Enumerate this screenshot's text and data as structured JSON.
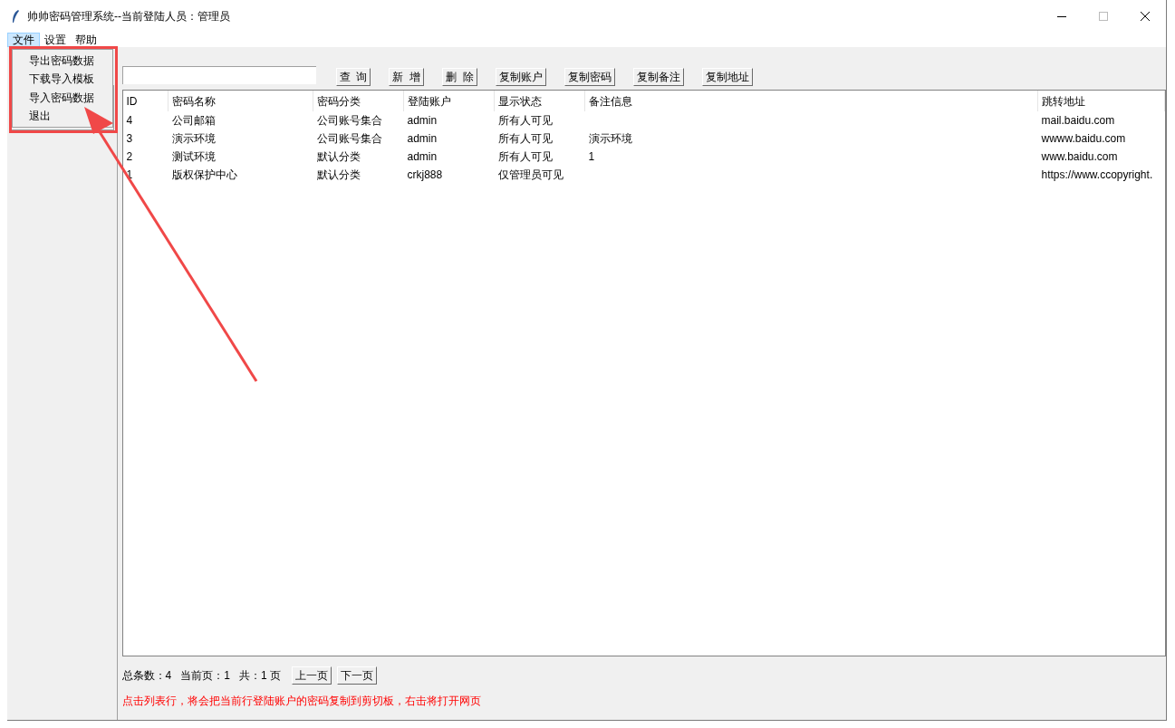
{
  "window": {
    "title": "帅帅密码管理系统--当前登陆人员：管理员"
  },
  "menu_bar": [
    {
      "label": "文件",
      "selected": true
    },
    {
      "label": "设置",
      "selected": false
    },
    {
      "label": "帮助",
      "selected": false
    }
  ],
  "dropdown_menu": [
    "导出密码数据",
    "下载导入模板",
    "导入密码数据",
    "退出"
  ],
  "toolbar": {
    "buttons": [
      "查  询",
      "新  增",
      "删  除",
      "复制账户",
      "复制密码",
      "复制备注",
      "复制地址"
    ]
  },
  "table": {
    "columns": [
      "ID",
      "密码名称",
      "密码分类",
      "登陆账户",
      "显示状态",
      "备注信息",
      "跳转地址"
    ],
    "rows": [
      [
        "4",
        "公司邮箱",
        "公司账号集合",
        "admin",
        "所有人可见",
        "",
        "mail.baidu.com"
      ],
      [
        "3",
        "演示环境",
        "公司账号集合",
        "admin",
        "所有人可见",
        "演示环境",
        "wwww.baidu.com"
      ],
      [
        "2",
        "测试环境",
        "默认分类",
        "admin",
        "所有人可见",
        "1",
        "www.baidu.com"
      ],
      [
        "1",
        "版权保护中心",
        "默认分类",
        "crkj888",
        "仅管理员可见",
        "",
        "https://www.ccopyright."
      ]
    ]
  },
  "pagination": {
    "total": "总条数：4",
    "current": "当前页：1",
    "pages": "共：1 页",
    "buttons": [
      "上一页",
      "下一页"
    ]
  },
  "hint": "点击列表行，将会把当前行登陆账户的密码复制到剪切板，右击将打开网页"
}
